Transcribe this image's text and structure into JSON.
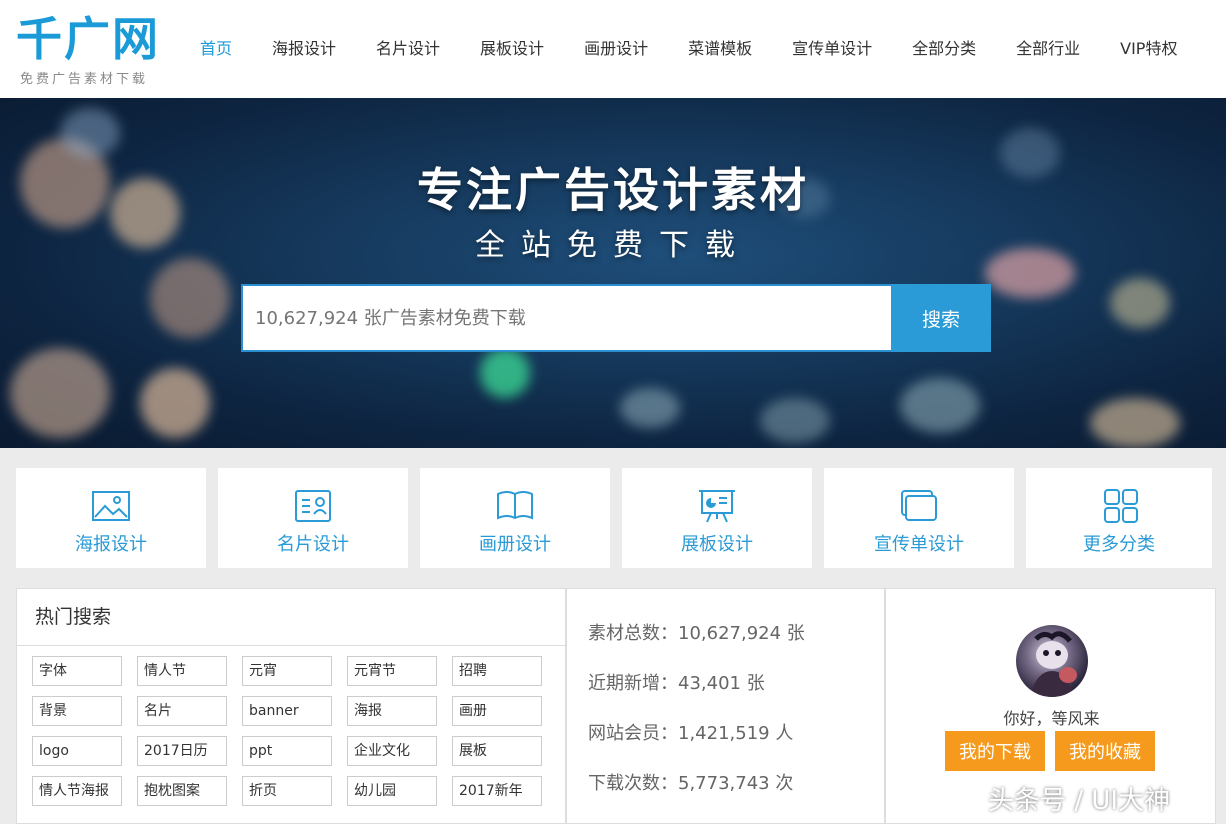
{
  "logo": {
    "main": "千广网",
    "sub": "免费广告素材下载"
  },
  "nav": [
    {
      "label": "首页",
      "active": true
    },
    {
      "label": "海报设计"
    },
    {
      "label": "名片设计"
    },
    {
      "label": "展板设计"
    },
    {
      "label": "画册设计"
    },
    {
      "label": "菜谱模板"
    },
    {
      "label": "宣传单设计"
    },
    {
      "label": "全部分类"
    },
    {
      "label": "全部行业"
    },
    {
      "label": "VIP特权"
    }
  ],
  "banner": {
    "title": "专注广告设计素材",
    "subtitle": "全站免费下载",
    "search_placeholder": "10,627,924 张广告素材免费下载",
    "search_button": "搜索"
  },
  "categories": [
    {
      "label": "海报设计",
      "icon": "image-icon"
    },
    {
      "label": "名片设计",
      "icon": "card-icon"
    },
    {
      "label": "画册设计",
      "icon": "book-icon"
    },
    {
      "label": "展板设计",
      "icon": "board-icon"
    },
    {
      "label": "宣传单设计",
      "icon": "layers-icon"
    },
    {
      "label": "更多分类",
      "icon": "grid-icon"
    }
  ],
  "hot_search": {
    "title": "热门搜索",
    "tags": [
      [
        "字体",
        "情人节",
        "元宵",
        "元宵节",
        "招聘"
      ],
      [
        "背景",
        "名片",
        "banner",
        "海报",
        "画册"
      ],
      [
        "logo",
        "2017日历",
        "ppt",
        "企业文化",
        "展板"
      ],
      [
        "情人节海报",
        "抱枕图案",
        "折页",
        "幼儿园",
        "2017新年"
      ]
    ]
  },
  "stats": [
    "素材总数：10,627,924 张",
    "近期新增：43,401 张",
    "网站会员：1,421,519 人",
    "下载次数：5,773,743 次"
  ],
  "user": {
    "greeting": "你好，等风来",
    "downloads_button": "我的下载",
    "favorites_button": "我的收藏"
  },
  "watermark": "头条号 / UI大神",
  "colors": {
    "accent": "#1a9bd7",
    "orange": "#f59a1d"
  }
}
